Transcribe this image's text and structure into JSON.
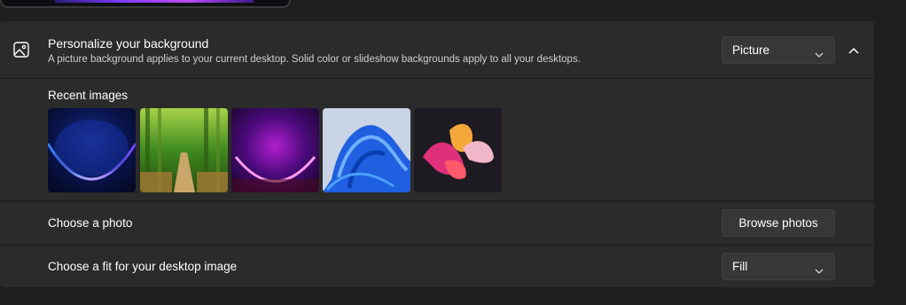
{
  "background_section": {
    "title": "Personalize your background",
    "description": "A picture background applies to your current desktop. Solid color or slideshow backgrounds apply to all your desktops.",
    "icon": "image-icon",
    "type_dropdown": {
      "selected": "Picture"
    },
    "collapse_icon": "chevron-up-icon"
  },
  "recent_images": {
    "label": "Recent images",
    "items": [
      {
        "name": "blue-bloom-wallpaper"
      },
      {
        "name": "bamboo-forest-wallpaper"
      },
      {
        "name": "purple-glow-wallpaper"
      },
      {
        "name": "blue-ribbon-wallpaper"
      },
      {
        "name": "colorful-flow-wallpaper"
      }
    ]
  },
  "choose_photo": {
    "label": "Choose a photo",
    "button_label": "Browse photos"
  },
  "choose_fit": {
    "label": "Choose a fit for your desktop image",
    "dropdown": {
      "selected": "Fill"
    }
  },
  "colors": {
    "page_bg": "#1f1f1f",
    "card_bg": "#2b2b2b",
    "control_bg": "#373737"
  }
}
